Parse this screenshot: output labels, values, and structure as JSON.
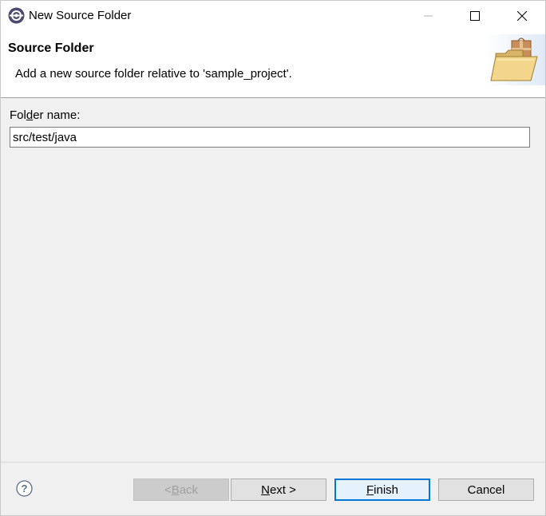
{
  "window": {
    "title": "New Source Folder",
    "controls": {
      "minimize": "minimize",
      "maximize": "maximize",
      "close": "close"
    }
  },
  "banner": {
    "title": "Source Folder",
    "description": "Add a new source folder relative to 'sample_project'."
  },
  "form": {
    "folder_label_pre": "Fol",
    "folder_label_mnemonic": "d",
    "folder_label_post": "er name:",
    "folder_value": "src/test/java"
  },
  "buttons": {
    "back_pre": "< ",
    "back_mnemonic": "B",
    "back_post": "ack",
    "next_mnemonic": "N",
    "next_post": "ext >",
    "finish_mnemonic": "F",
    "finish_post": "inish",
    "cancel": "Cancel"
  },
  "icons": {
    "app": "eclipse-icon",
    "banner": "folder-package-icon",
    "help": "help-icon"
  }
}
